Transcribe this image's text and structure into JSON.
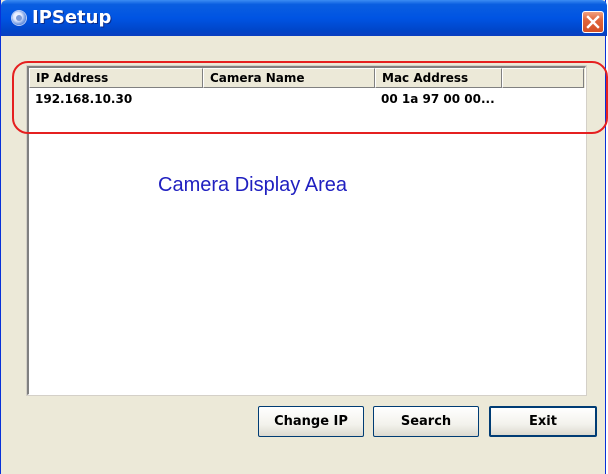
{
  "window": {
    "title": "IPSetup",
    "title_icon": "app-icon",
    "close_icon": "close-icon",
    "accent_color": "#0054e3",
    "close_color": "#d44f25"
  },
  "camera_list": {
    "columns": [
      "IP Address",
      "Camera Name",
      "Mac Address",
      ""
    ],
    "rows": [
      {
        "ip": "192.168.10.30",
        "name": "",
        "mac": "00 1a 97 00 00..."
      }
    ],
    "highlight_color": "#e52020"
  },
  "display_area": {
    "label": "Camera Display Area",
    "label_color": "#2020c0"
  },
  "buttons": {
    "change_ip": "Change IP",
    "search": "Search",
    "exit": "Exit"
  }
}
